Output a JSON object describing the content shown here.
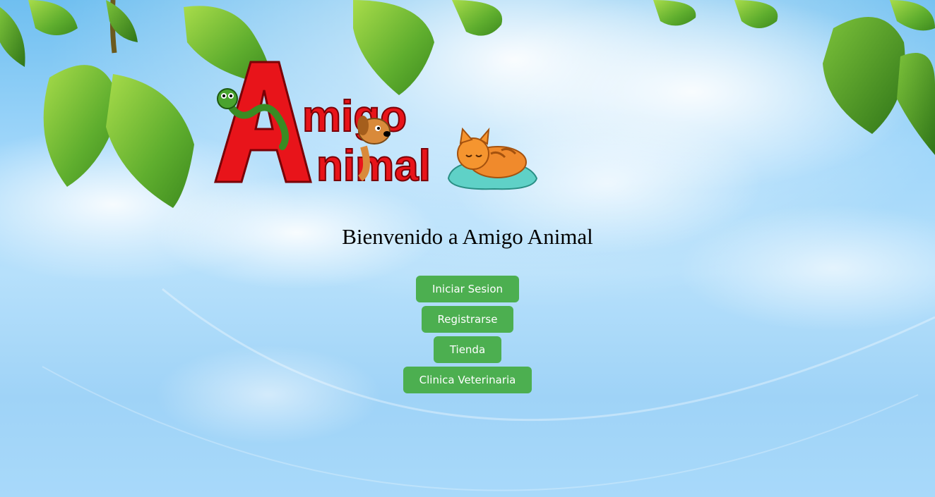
{
  "logo": {
    "line1": "Amigo",
    "line2": "Animal",
    "text_color": "#e8141a"
  },
  "welcome": {
    "title": "Bienvenido a Amigo Animal"
  },
  "menu": {
    "buttons": [
      {
        "id": "login",
        "label": "Iniciar Sesion"
      },
      {
        "id": "register",
        "label": "Registrarse"
      },
      {
        "id": "store",
        "label": "Tienda"
      },
      {
        "id": "vet",
        "label": "Clinica Veterinaria"
      }
    ],
    "button_color": "#4caf50",
    "button_text_color": "#ffffff"
  },
  "background": {
    "sky_color": "#9fd6fa",
    "leaf_color": "#5fae2e"
  }
}
